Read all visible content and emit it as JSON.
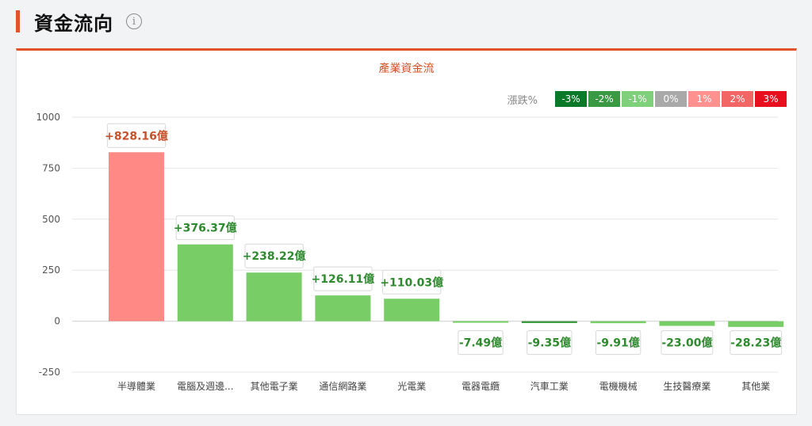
{
  "header": {
    "title": "資金流向",
    "info_icon": "info-icon"
  },
  "legend": {
    "label": "漲跌%",
    "items": [
      {
        "label": "-3%",
        "color": "#0a7a2a"
      },
      {
        "label": "-2%",
        "color": "#3a9a44"
      },
      {
        "label": "-1%",
        "color": "#7fd07a"
      },
      {
        "label": "0%",
        "color": "#a9a9a9"
      },
      {
        "label": "1%",
        "color": "#ff9191"
      },
      {
        "label": "2%",
        "color": "#f26666"
      },
      {
        "label": "3%",
        "color": "#e8101f"
      }
    ]
  },
  "chart_data": {
    "type": "bar",
    "title": "產業資金流",
    "categories": [
      "半導體業",
      "電腦及週邊...",
      "其他電子業",
      "通信網路業",
      "光電業",
      "電器電纜",
      "汽車工業",
      "電機機械",
      "生技醫療業",
      "其他業"
    ],
    "values": [
      828.16,
      376.37,
      238.22,
      126.11,
      110.03,
      -7.49,
      -9.35,
      -9.91,
      -23.0,
      -28.23
    ],
    "value_labels": [
      "+828.16億",
      "+376.37億",
      "+238.22億",
      "+126.11億",
      "+110.03億",
      "-7.49億",
      "-9.35億",
      "-9.91億",
      "-23.00億",
      "-28.23億"
    ],
    "bar_colors": [
      "#ff8a85",
      "#79cd66",
      "#79cd66",
      "#79cd66",
      "#79cd66",
      "#79cd66",
      "#3d9b40",
      "#79cd66",
      "#79cd66",
      "#79cd66"
    ],
    "label_colors": [
      "#c8502a",
      "#2e8a2e",
      "#2e8a2e",
      "#2e8a2e",
      "#2e8a2e",
      "#2e8a2e",
      "#2e8a2e",
      "#2e8a2e",
      "#2e8a2e",
      "#2e8a2e"
    ],
    "yticks": [
      1000,
      750,
      500,
      250,
      0,
      -250
    ],
    "ylim": [
      -250,
      1000
    ],
    "grid": true
  }
}
